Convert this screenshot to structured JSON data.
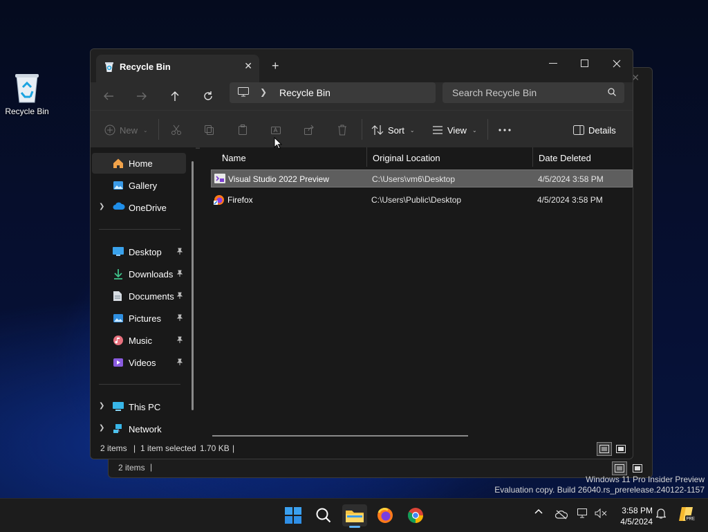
{
  "desktop": {
    "recycle_bin_label": "Recycle Bin"
  },
  "back_window": {
    "status_items": "2 items"
  },
  "window": {
    "tab_title": "Recycle Bin",
    "address": {
      "crumb": "Recycle Bin"
    },
    "search": {
      "placeholder": "Search Recycle Bin"
    },
    "toolbar": {
      "new_label": "New",
      "sort_label": "Sort",
      "view_label": "View",
      "details_label": "Details"
    },
    "sidebar": {
      "items": [
        {
          "label": "Home",
          "icon": "home-icon"
        },
        {
          "label": "Gallery",
          "icon": "gallery-icon"
        },
        {
          "label": "OneDrive",
          "icon": "cloud-icon"
        },
        {
          "label": "Desktop",
          "icon": "desktop-folder-icon"
        },
        {
          "label": "Downloads",
          "icon": "download-icon"
        },
        {
          "label": "Documents",
          "icon": "documents-icon"
        },
        {
          "label": "Pictures",
          "icon": "pictures-icon"
        },
        {
          "label": "Music",
          "icon": "music-icon"
        },
        {
          "label": "Videos",
          "icon": "videos-icon"
        },
        {
          "label": "This PC",
          "icon": "this-pc-icon"
        },
        {
          "label": "Network",
          "icon": "network-icon"
        }
      ]
    },
    "columns": {
      "name": "Name",
      "original_location": "Original Location",
      "date_deleted": "Date Deleted"
    },
    "files": [
      {
        "name": "Visual Studio 2022 Preview",
        "location": "C:\\Users\\vm6\\Desktop",
        "date": "4/5/2024 3:58 PM",
        "icon": "visual-studio-icon",
        "selected": true
      },
      {
        "name": "Firefox",
        "location": "C:\\Users\\Public\\Desktop",
        "date": "4/5/2024 3:58 PM",
        "icon": "firefox-icon",
        "selected": false
      }
    ],
    "status": {
      "items": "2 items",
      "selected": "1 item selected",
      "size": "1.70 KB"
    }
  },
  "watermark": {
    "line1": "Windows 11 Pro Insider Preview",
    "line2": "Evaluation copy. Build 26040.rs_prerelease.240122-1157"
  },
  "clock": {
    "time": "3:58 PM",
    "date": "4/5/2024"
  },
  "colors": {
    "accent": "#5fb2f2",
    "selected_row": "#5e5e5e",
    "window_bg": "#191919"
  }
}
